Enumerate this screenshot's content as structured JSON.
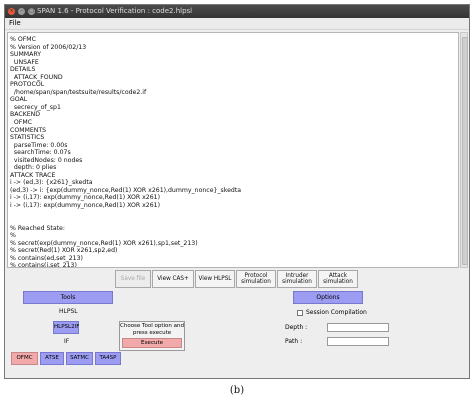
{
  "window": {
    "title": "SPAN 1.6 - Protocol Verification : code2.hlpsl",
    "controls": {
      "close": "×",
      "minimize": "–",
      "maximize": "□"
    }
  },
  "menu": {
    "file": "File"
  },
  "output_text": [
    "% OFMC",
    "% Version of 2006/02/13",
    "SUMMARY",
    "  UNSAFE",
    "DETAILS",
    "  ATTACK_FOUND",
    "PROTOCOL",
    "  /home/span/span/testsuite/results/code2.if",
    "GOAL",
    "  secrecy_of_sp1",
    "BACKEND",
    "  OFMC",
    "COMMENTS",
    "STATISTICS",
    "  parseTime: 0.00s",
    "  searchTime: 0.07s",
    "  visitedNodes: 0 nodes",
    "  depth: 0 plies",
    "ATTACK TRACE",
    "i -> (ed,3): {x261}_skedta",
    "(ed,3) -> i: {exp(dummy_nonce,Red(1) XOR x261),dummy_nonce}_skedta",
    "i -> (i,17): exp(dummy_nonce,Red(1) XOR x261)",
    "i -> (i,17): exp(dummy_nonce,Red(1) XOR x261)",
    "",
    "",
    "% Reached State:",
    "%",
    "% secret(exp(dummy_nonce,Red(1) XOR x261),sp1,set_213)",
    "% secret(Red(1) XOR x261,sp2,ed)",
    "% contains(ed,set_213)",
    "% contains(i,set_213)",
    "% contains(ta,set_213)",
    "% state_eddevice(ed,i,ta,skedta,h,0,dummy_nonce,dummy_nonce,dummy_nonce,dummy_nonce,dummy_nonce,dummy_nonce,du",
    "mmy_nonce,dummy_nonce,dummy_nonce,dummy_nonce,dummy_nonce,dummy_nonce,dummy_nonce,dummy_nonce,dummy_no"
  ],
  "toolbar": {
    "save_file": "Save file",
    "view_cas": "View CAS+",
    "view_hlpsl": "View HLPSL",
    "protocol_sim": [
      "Protocol",
      "simulation"
    ],
    "intruder_sim": [
      "Intruder",
      "simulation"
    ],
    "attack_sim": [
      "Attack",
      "simulation"
    ]
  },
  "tools_panel": {
    "tools_label": "Tools",
    "hlpsl_label": "HLPSL",
    "hlpsl2if_label": "HLPSL2IF",
    "if_label": "IF",
    "message_line1": "Choose Tool option and",
    "message_line2": "press execute",
    "execute_label": "Execute",
    "backends": [
      "OFMC",
      "ATSE",
      "SATMC",
      "TA4SP"
    ],
    "active_backend": "OFMC"
  },
  "options_panel": {
    "options_label": "Options",
    "session_compilation": "Session Compilation",
    "session_compilation_checked": false,
    "depth_label": "Depth :",
    "depth_value": "",
    "path_label": "Path :",
    "path_value": ""
  },
  "caption": "(b)",
  "colors": {
    "tool_button": "#9c9cf3",
    "active_button": "#f2a9a9",
    "titlebar": "#3c3c3c"
  }
}
